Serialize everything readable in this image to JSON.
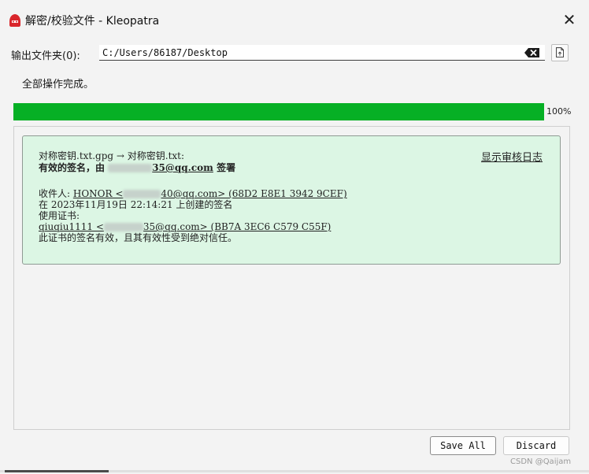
{
  "window": {
    "title": "解密/校验文件 - Kleopatra",
    "close_glyph": "✕",
    "app_icon": "kleopatra-icon"
  },
  "output": {
    "label": "输出文件夹(0):",
    "value": "C:/Users/86187/Desktop",
    "clear_icon": "backspace-clear-icon",
    "browse_icon": "file-browse-icon"
  },
  "status_text": "全部操作完成。",
  "progress": {
    "value": 1.0,
    "label": "100%",
    "color": "#06b025"
  },
  "result": {
    "line1": "对称密钥.txt.gpg → 对称密钥.txt:",
    "sig_prefix": "有效的签名，由",
    "sig_email_tail": "35@qq.com",
    "sig_suffix": "签署",
    "show_log": "显示审核日志",
    "recipient_label": "收件人:",
    "recipient_name": "HONOR <",
    "recipient_tail": "40@qq.com> (68D2 E8E1 3942 9CEF)",
    "created_line": "在 2023年11月19日 22:14:21 上创建的签名",
    "cert_label": "使用证书:",
    "cert_name": "qiuqiu1111 <",
    "cert_tail": "35@qq.com> (BB7A 3EC6 C579 C55F)",
    "trust_line": "此证书的签名有效，且其有效性受到绝对信任。",
    "background": "#dcf6e4"
  },
  "buttons": {
    "save_all": "Save All",
    "discard": "Discard"
  },
  "watermark": "CSDN @Qaijam"
}
